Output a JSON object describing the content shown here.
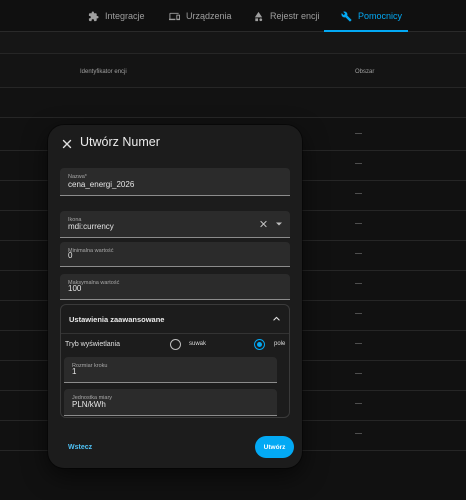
{
  "tabs": [
    {
      "label": "Integracje",
      "icon": "puzzle-icon"
    },
    {
      "label": "Urządzenia",
      "icon": "devices-icon"
    },
    {
      "label": "Rejestr encji",
      "icon": "entities-icon"
    },
    {
      "label": "Pomocnicy",
      "icon": "tools-icon",
      "active": true
    }
  ],
  "table": {
    "columns": [
      "Identyfikator encji",
      "Obszar"
    ],
    "area_placeholder": "—"
  },
  "dialog": {
    "title": "Utwórz Numer",
    "fields": {
      "name": {
        "label": "Nazwa*",
        "value": "cena_energi_2026"
      },
      "icon": {
        "label": "Ikona",
        "value": "mdi:currency"
      },
      "min": {
        "label": "Minimalna wartość",
        "value": "0"
      },
      "max": {
        "label": "Maksymalna wartość",
        "value": "100"
      }
    },
    "advanced": {
      "header": "Ustawienia zaawansowane",
      "display_mode_label": "Tryb wyświetlania",
      "options": [
        {
          "label": "suwak",
          "checked": false
        },
        {
          "label": "pole",
          "checked": true
        }
      ],
      "step": {
        "label": "Rozmiar kroku",
        "value": "1"
      },
      "unit": {
        "label": "Jednostka miary",
        "value": "PLN/kWh"
      }
    },
    "buttons": {
      "back": "Wstecz",
      "create": "Utwórz"
    }
  },
  "colors": {
    "accent": "#03a9f4",
    "background": "#111111",
    "dialog": "#1c1c1c",
    "field": "#2b2b2b"
  }
}
